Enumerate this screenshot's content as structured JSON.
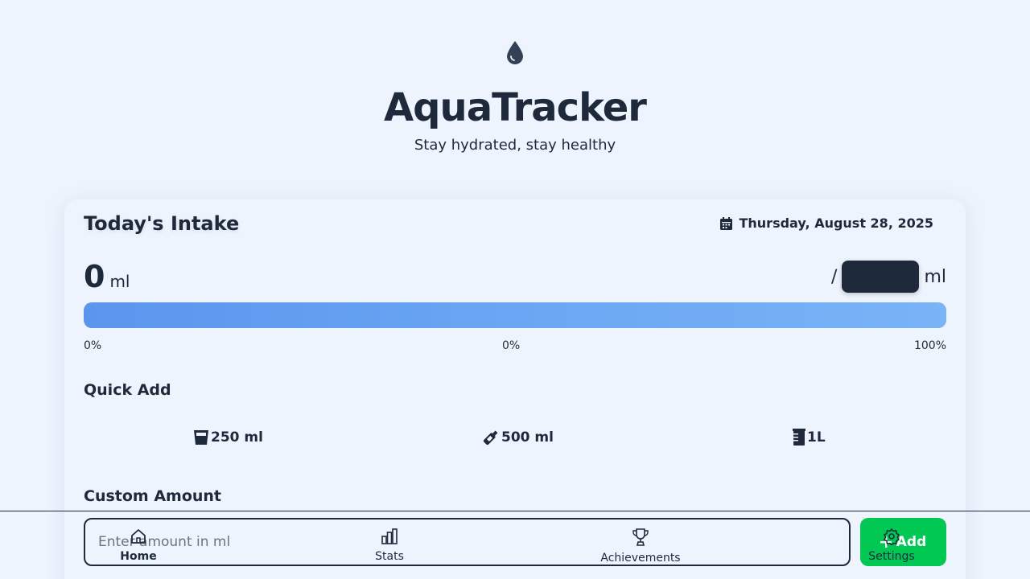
{
  "header": {
    "title": "AquaTracker",
    "subtitle": "Stay hydrated, stay healthy",
    "logo_icon": "water-drop-icon"
  },
  "intake": {
    "title": "Today's Intake",
    "date": "Thursday, August 28, 2025",
    "date_icon": "calendar-icon",
    "current_value": "0",
    "current_unit": "ml",
    "goal_separator": "/",
    "goal_value": "",
    "goal_unit": "ml",
    "progress_fraction": 0,
    "progress_labels": {
      "start": "0%",
      "current": "0%",
      "end": "100%"
    }
  },
  "quick_add": {
    "title": "Quick Add",
    "options": [
      {
        "label": "250 ml",
        "icon": "glass-icon"
      },
      {
        "label": "500 ml",
        "icon": "bottle-icon"
      },
      {
        "label": "1L",
        "icon": "jug-icon"
      }
    ]
  },
  "custom_amount": {
    "title": "Custom Amount",
    "placeholder": "Enter amount in ml",
    "button_label": "Add",
    "button_icon": "plus-icon",
    "button_color": "#00c853"
  },
  "bottom_nav": {
    "items": [
      {
        "label": "Home",
        "icon": "home-icon",
        "active": true
      },
      {
        "label": "Stats",
        "icon": "bar-chart-icon",
        "active": false
      },
      {
        "label": "Achievements",
        "icon": "trophy-icon",
        "active": false
      },
      {
        "label": "Settings",
        "icon": "gear-icon",
        "active": false
      }
    ]
  },
  "colors": {
    "background": "#eef4fd",
    "text": "#1e293b",
    "progress_start": "#5b95ee",
    "progress_end": "#7ab3f6",
    "accent_green": "#00c853"
  }
}
